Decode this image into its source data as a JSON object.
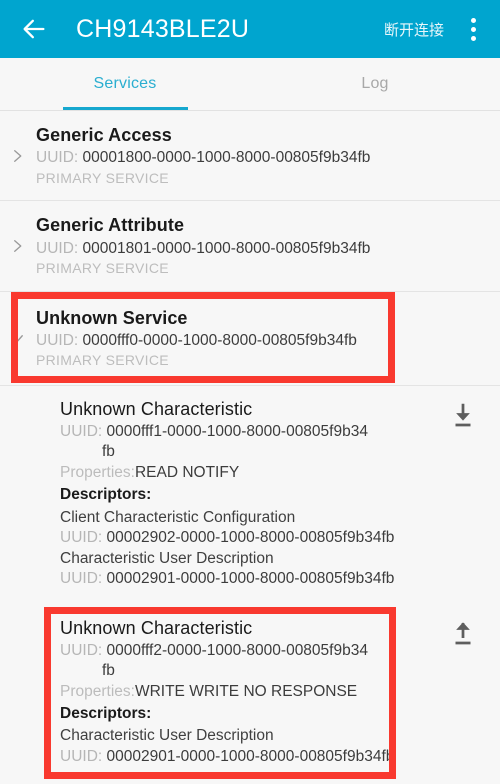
{
  "appbar": {
    "back_icon": "arrow-left-icon",
    "title": "CH9143BLE2U",
    "disconnect_label": "断开连接",
    "overflow_icon": "more-vertical-icon",
    "background_color": "#00a5cf"
  },
  "tabs": {
    "items": [
      {
        "label": "Services",
        "active": true
      },
      {
        "label": "Log",
        "active": false
      }
    ],
    "active_color": "#2aaed0",
    "inactive_color": "#a8a8a8",
    "indicator_color": "#16a8cf"
  },
  "labels": {
    "uuid_prefix": "UUID:",
    "properties_prefix": "Properties:",
    "descriptors_heading": "Descriptors:"
  },
  "services": [
    {
      "name": "Generic Access",
      "uuid": "00001800-0000-1000-8000-00805f9b34fb",
      "type": "PRIMARY SERVICE",
      "expanded": false,
      "chevron_icon": "chevron-right-icon"
    },
    {
      "name": "Generic Attribute",
      "uuid": "00001801-0000-1000-8000-00805f9b34fb",
      "type": "PRIMARY SERVICE",
      "expanded": false,
      "chevron_icon": "chevron-right-icon"
    },
    {
      "name": "Unknown Service",
      "uuid": "0000fff0-0000-1000-8000-00805f9b34fb",
      "type": "PRIMARY SERVICE",
      "expanded": true,
      "chevron_icon": "chevron-down-icon",
      "highlighted": true
    }
  ],
  "characteristics": [
    {
      "name": "Unknown Characteristic",
      "uuid_line1": "0000fff1-0000-1000-8000-00805f9b34",
      "uuid_line2": "fb",
      "properties": "READ NOTIFY",
      "action_icon": "download-icon",
      "descriptors": [
        {
          "name": "Client Characteristic Configuration",
          "uuid": "00002902-0000-1000-8000-00805f9b34fb"
        },
        {
          "name": "Characteristic User Description",
          "uuid": "00002901-0000-1000-8000-00805f9b34fb"
        }
      ],
      "highlighted": false
    },
    {
      "name": "Unknown Characteristic",
      "uuid_line1": "0000fff2-0000-1000-8000-00805f9b34",
      "uuid_line2": "fb",
      "properties": "WRITE WRITE NO RESPONSE",
      "action_icon": "upload-icon",
      "descriptors": [
        {
          "name": "Characteristic User Description",
          "uuid": "00002901-0000-1000-8000-00805f9b34fb"
        }
      ],
      "highlighted": true
    }
  ],
  "annotations": {
    "highlight_color": "#f9392f",
    "boxes": [
      {
        "target": "unknown-service-row"
      },
      {
        "target": "unknown-characteristic-write-row"
      }
    ]
  }
}
